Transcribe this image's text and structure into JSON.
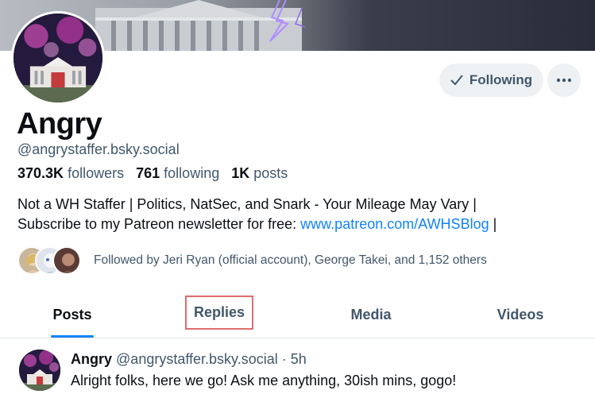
{
  "profile": {
    "display_name": "Angry",
    "handle": "@angrystaffer.bsky.social",
    "stats": {
      "followers_count": "370.3K",
      "followers_label": "followers",
      "following_count": "761",
      "following_label": "following",
      "posts_count": "1K",
      "posts_label": "posts"
    },
    "bio_line1": "Not a WH Staffer | Politics, NatSec, and Snark - Your Mileage May Vary |",
    "bio_line2_prefix": "Subscribe to my Patreon newsletter for free: ",
    "bio_link": "www.patreon.com/AWHSBlog",
    "bio_line2_suffix": " |",
    "followed_by": "Followed by Jeri Ryan (official account), George Takei, and 1,152 others"
  },
  "actions": {
    "following_label": "Following",
    "more_icon": "ellipsis-icon",
    "check_icon": "check-icon"
  },
  "tabs": [
    {
      "label": "Posts",
      "active": true
    },
    {
      "label": "Replies",
      "active": false
    },
    {
      "label": "Media",
      "active": false
    },
    {
      "label": "Videos",
      "active": false
    }
  ],
  "post": {
    "author_name": "Angry",
    "author_handle": "@angrystaffer.bsky.social",
    "separator": " · ",
    "time": "5h",
    "text": "Alright folks, here we go! Ask me anything, 30ish mins, gogo!"
  },
  "colors": {
    "accent": "#1083fe",
    "muted_text": "#42576c",
    "button_bg": "#eef1f4",
    "tab_highlight_outline": "#e06c6c"
  }
}
